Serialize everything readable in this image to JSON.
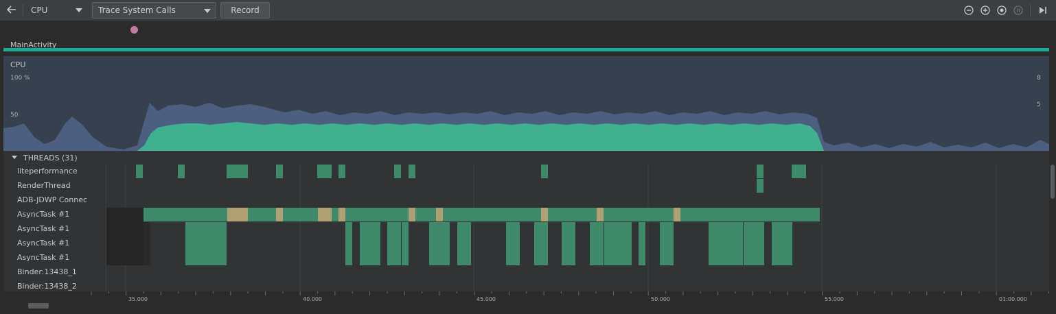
{
  "toolbar": {
    "back_icon": "back-arrow-icon",
    "profiler_select": "CPU",
    "trace_select": "Trace System Calls",
    "record_label": "Record",
    "icons": [
      "zoom-out-icon",
      "zoom-in-icon",
      "reset-zoom-icon",
      "pause-icon",
      "go-live-icon"
    ]
  },
  "events": {
    "marker": "user-event-dot"
  },
  "activity": {
    "label": "MainActivity",
    "color": "#1faa94"
  },
  "cpu": {
    "label": "CPU",
    "left_axis": {
      "top": "100 %",
      "mid": "50"
    },
    "right_axis": {
      "top": "8",
      "mid": "5"
    },
    "colors": {
      "total": "#4d5f80",
      "app": "#3fb18e"
    }
  },
  "threads": {
    "title": "THREADS (31)",
    "names": [
      "liteperformance",
      "RenderThread",
      "ADB-JDWP Connec",
      "AsyncTask #1",
      "AsyncTask #1",
      "AsyncTask #1",
      "AsyncTask #1",
      "Binder:13438_1",
      "Binder:13438_2"
    ],
    "colors": {
      "running": "#3e8a6a",
      "waiting": "#b0a073",
      "sleeping": "#262626"
    }
  },
  "timeline": {
    "ticks": [
      "35.000",
      "40.000",
      "45.000",
      "50.000",
      "55.000",
      "01:00.000"
    ]
  }
}
